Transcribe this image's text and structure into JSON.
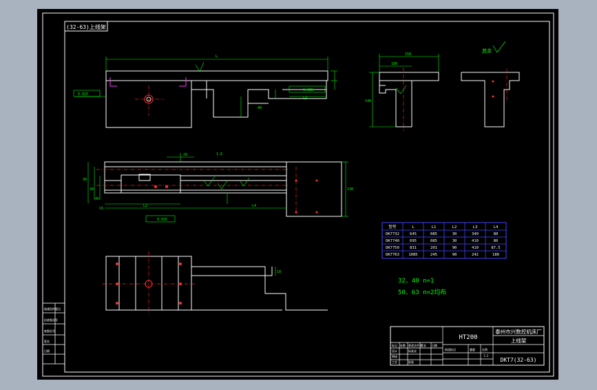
{
  "drawing": {
    "code_box": "(32-63)上线架",
    "material": "HT200",
    "company": "泰州市兴数控机床厂",
    "part_name": "上线架",
    "drawing_number": "DKT7(32-63)",
    "roughness_label": "其余",
    "note_1": "32、40  n=1",
    "note_2": "50、63  n=2均布"
  },
  "colors": {
    "sheet": "#000000",
    "border": "#ffffff",
    "outline": "#ffffff",
    "dimension": "#00ff00",
    "centerline": "#ff2020",
    "table_line": "#4444ff",
    "background": "#a9b3bf"
  },
  "table": {
    "headers": [
      "型号",
      "L",
      "L1",
      "L2",
      "L3",
      "L4"
    ],
    "rows": [
      [
        "DK7732",
        "645",
        "085",
        "30",
        "340",
        "80"
      ],
      [
        "DK7740",
        "695",
        "085",
        "30",
        "410",
        "80"
      ],
      [
        "DK7750",
        "831",
        "201",
        "90",
        "410",
        "87.5"
      ],
      [
        "DK7763",
        "1085",
        "245",
        "90",
        "242",
        "180"
      ]
    ]
  },
  "dimensions": {
    "L": "L",
    "L1": "L1",
    "L2": "L2",
    "L3": "L3",
    "L4": "L4",
    "ra_16": "1.6",
    "ra_32": "3.2",
    "flatness_1": "0.025",
    "flatness_2": "0.025",
    "flatness_3": "0.025",
    "w_150": "150",
    "w_100": "100",
    "h_140": "140",
    "v_30": "30",
    "v_38": "38",
    "v_40": "40",
    "v_45": "45",
    "v_10": "10",
    "c6_10": "C6",
    "d_29": "29",
    "d_130": "130"
  },
  "title_block_small": {
    "cells": [
      "标记",
      "处数",
      "更改文件号",
      "签名",
      "日期",
      "设计",
      "标准化",
      "审核",
      "工艺",
      "批准",
      "阶段标记",
      "重量",
      "比例"
    ],
    "scale": "1:2"
  },
  "side_strip": [
    "借通用件登记",
    "旧底图总号",
    "底图总号",
    "签名",
    "日期"
  ]
}
